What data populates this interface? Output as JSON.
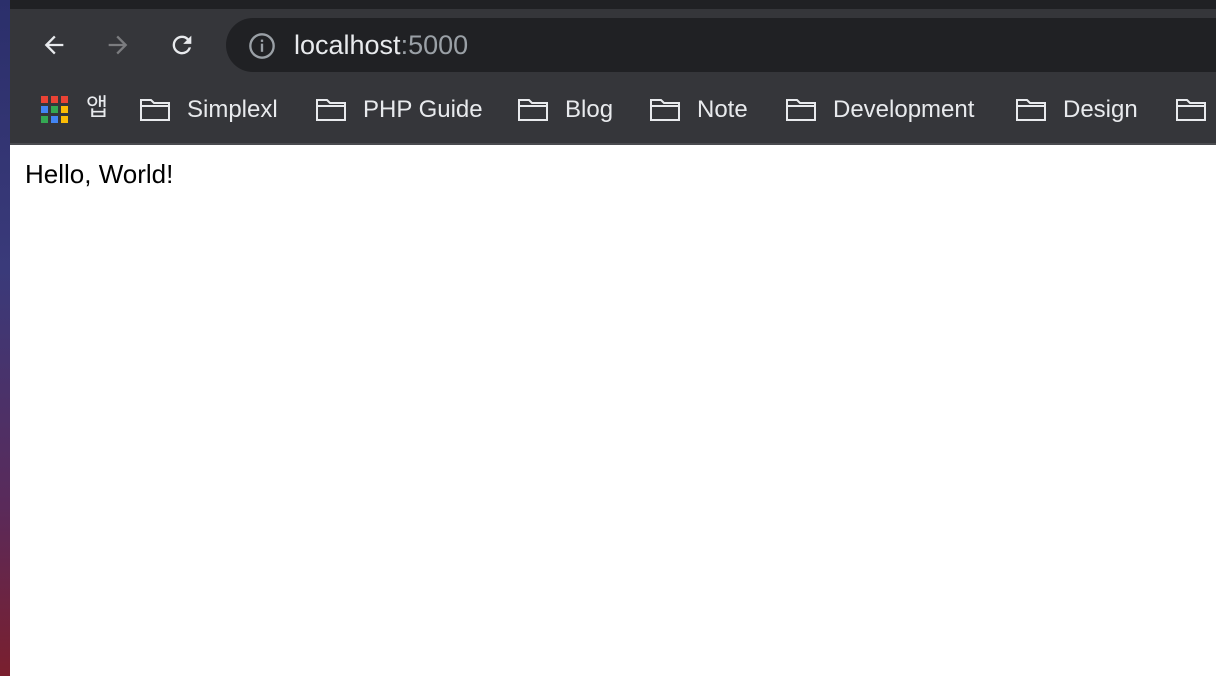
{
  "browser": {
    "url": {
      "host": "localhost",
      "port": ":5000"
    },
    "nav": {
      "back_icon": "arrow-left-icon",
      "forward_icon": "arrow-right-icon",
      "reload_icon": "reload-icon",
      "info_icon": "info-icon"
    },
    "bookmarks": {
      "apps_label": "앱",
      "items": [
        {
          "label": "Simplexl"
        },
        {
          "label": "PHP Guide"
        },
        {
          "label": "Blog"
        },
        {
          "label": "Note"
        },
        {
          "label": "Development"
        },
        {
          "label": "Design"
        },
        {
          "label": ""
        }
      ]
    },
    "colors": {
      "toolbar": "#35363a",
      "omnibox": "#202124",
      "text": "#e8eaed",
      "muted": "#9aa0a6"
    }
  },
  "page": {
    "body_text": "Hello, World!"
  }
}
